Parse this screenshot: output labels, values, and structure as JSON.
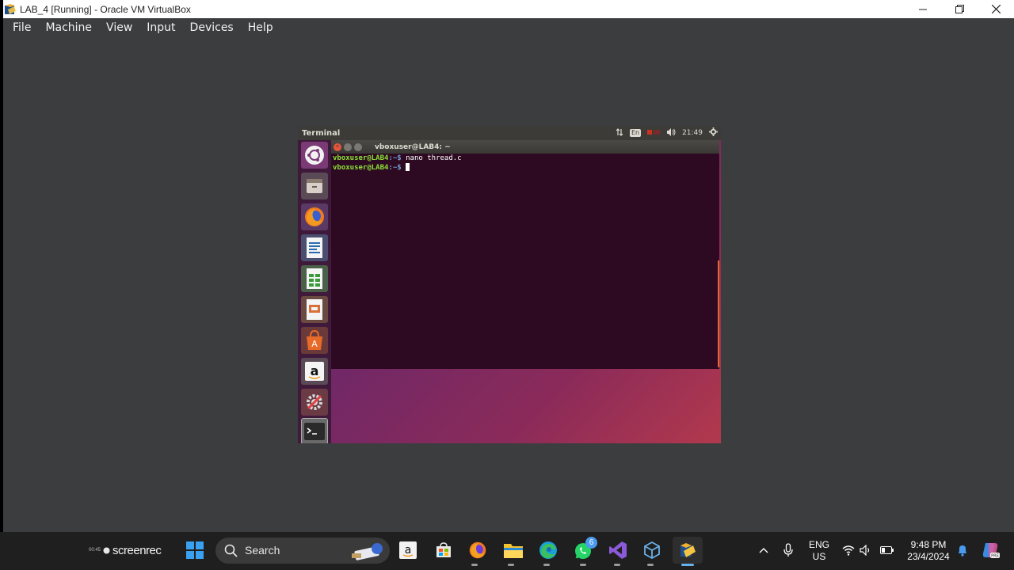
{
  "window": {
    "title": "LAB_4 [Running] - Oracle VM VirtualBox"
  },
  "menu": [
    "File",
    "Machine",
    "View",
    "Input",
    "Devices",
    "Help"
  ],
  "guest": {
    "topbar": {
      "title": "Terminal",
      "lang": "En",
      "time": "21:49"
    },
    "launcher": [
      "ubuntu-logo-icon",
      "files-icon",
      "firefox-icon",
      "writer-icon",
      "calc-icon",
      "impress-icon",
      "software-center-icon",
      "amazon-icon",
      "settings-icon",
      "terminal-icon"
    ],
    "terminal": {
      "title": "vboxuser@LAB4: ~",
      "lines": [
        {
          "user": "vboxuser@LAB4",
          "path": ":~$",
          "cmd": " nano thread.c"
        },
        {
          "user": "vboxuser@LAB4",
          "path": ":~$",
          "cmd": " "
        }
      ]
    }
  },
  "taskbar": {
    "recorder": {
      "time": "00:45",
      "brand": "screenrec"
    },
    "search": {
      "label": "Search"
    },
    "whatsapp_badge": "6",
    "tray": {
      "lang_line1": "ENG",
      "lang_line2": "US",
      "time": "9:48 PM",
      "date": "23/4/2024"
    }
  },
  "colors": {
    "accent_orange": "#e95420",
    "terminal_bg": "#2d0922",
    "prompt_green": "#8ae234",
    "prompt_blue": "#729fcf"
  }
}
